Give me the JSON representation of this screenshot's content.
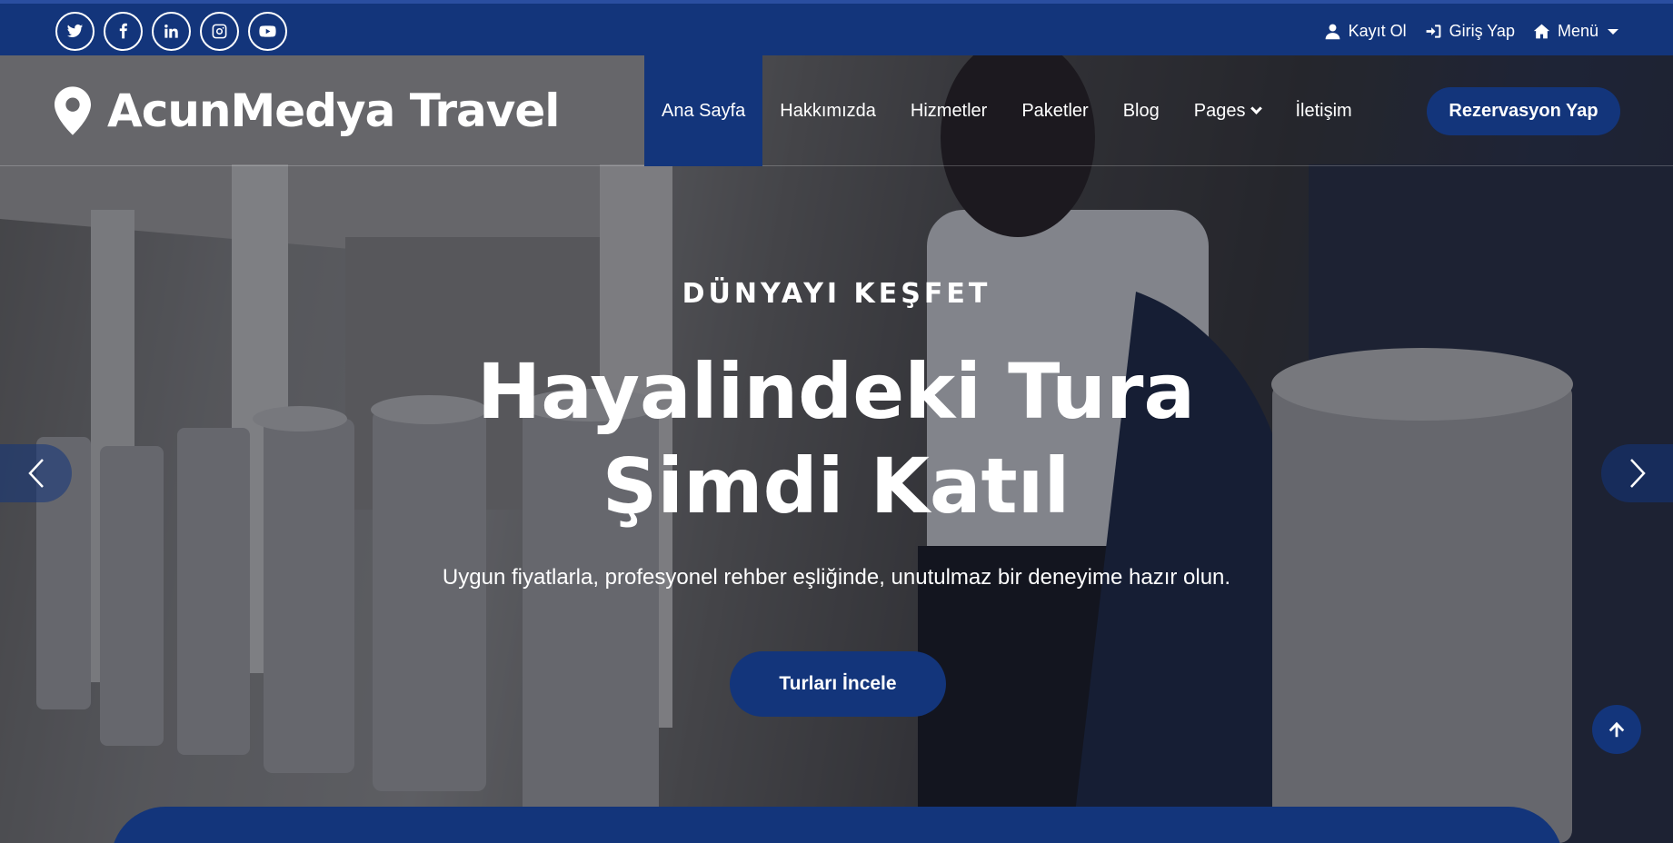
{
  "colors": {
    "primary": "#13357b",
    "text": "#ffffff"
  },
  "topbar": {
    "socials": [
      {
        "icon": "twitter-icon"
      },
      {
        "icon": "facebook-icon"
      },
      {
        "icon": "linkedin-icon"
      },
      {
        "icon": "instagram-icon"
      },
      {
        "icon": "youtube-icon"
      }
    ],
    "register_label": "Kayıt Ol",
    "login_label": "Giriş Yap",
    "menu_label": "Menü"
  },
  "navbar": {
    "brand": "AcunMedya Travel",
    "items": [
      {
        "label": "Ana Sayfa"
      },
      {
        "label": "Hakkımızda"
      },
      {
        "label": "Hizmetler"
      },
      {
        "label": "Paketler"
      },
      {
        "label": "Blog"
      },
      {
        "label": "Pages"
      },
      {
        "label": "İletişim"
      }
    ],
    "cta_label": "Rezervasyon Yap"
  },
  "hero": {
    "eyebrow": "DÜNYAYI KEŞFET",
    "headline": "Hayalindeki Tura Şimdi Katıl",
    "subtext": "Uygun fiyatlarla, profesyonel rehber eşliğinde, unutulmaz bir deneyime hazır olun.",
    "button_label": "Turları İncele"
  }
}
